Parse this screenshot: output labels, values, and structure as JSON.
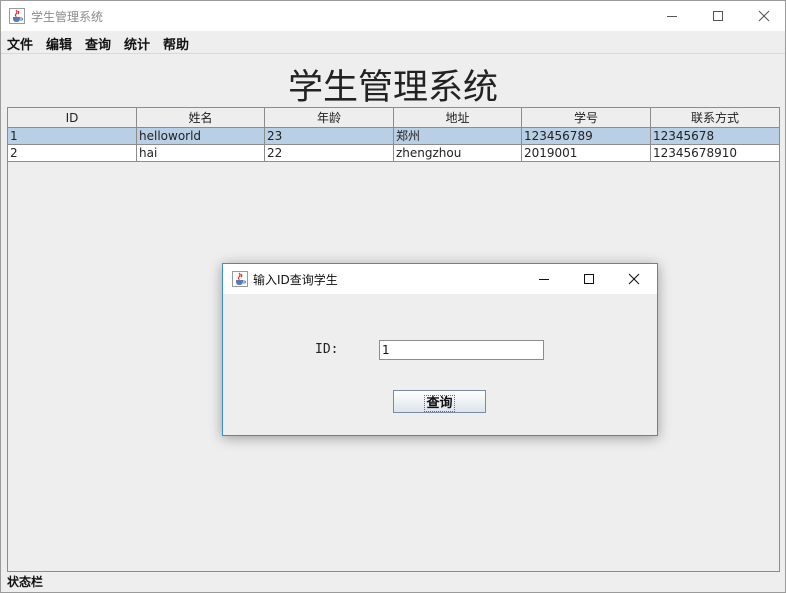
{
  "window": {
    "title": "学生管理系统",
    "icon": "java-cup-icon",
    "controls": [
      "minimize-icon",
      "maximize-icon",
      "close-icon"
    ]
  },
  "menu": {
    "items": [
      "文件",
      "编辑",
      "查询",
      "统计",
      "帮助"
    ]
  },
  "heading": "学生管理系统",
  "table": {
    "columns": [
      "ID",
      "姓名",
      "年龄",
      "地址",
      "学号",
      "联系方式"
    ],
    "rows": [
      [
        "1",
        "helloworld",
        "23",
        "郑州",
        "123456789",
        "12345678"
      ],
      [
        "2",
        "hai",
        "22",
        "zhengzhou",
        "2019001",
        "12345678910"
      ]
    ],
    "selected_row": 0,
    "selection_color": "#b8cfe5"
  },
  "status_bar": "状态栏",
  "dialog": {
    "title": "输入ID查询学生",
    "icon": "java-cup-icon",
    "field_label": "ID:",
    "field_value": "1",
    "button_label": "查询",
    "border_color": "#3c8ed1"
  }
}
